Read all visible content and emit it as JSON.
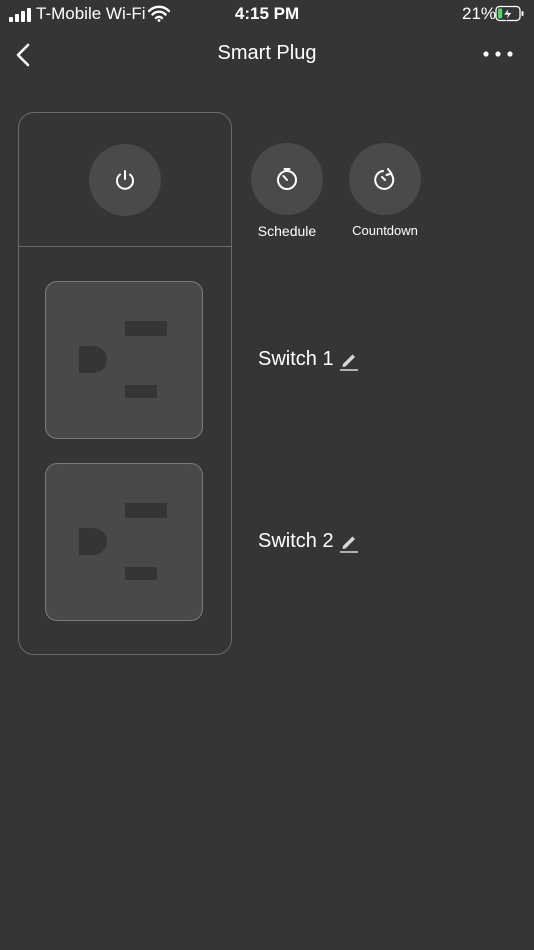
{
  "status_bar": {
    "carrier": "T-Mobile Wi-Fi",
    "time": "4:15 PM",
    "battery_percent": "21%",
    "battery_level": 0.21,
    "icons": [
      "signal-bars-icon",
      "wifi-icon",
      "battery-charging-icon"
    ]
  },
  "nav": {
    "title": "Smart Plug",
    "back_icon": "chevron-left-icon",
    "more_icon": "more-horizontal-icon"
  },
  "controls": {
    "power_icon": "power-icon",
    "schedule_icon": "timer-icon",
    "schedule_label": "Schedule",
    "countdown_icon": "countdown-icon",
    "countdown_label": "Countdown"
  },
  "switches": [
    {
      "label": "Switch 1",
      "edit_icon": "pencil-icon"
    },
    {
      "label": "Switch 2",
      "edit_icon": "pencil-icon"
    }
  ],
  "colors": {
    "background": "#363437",
    "button": "#4b494c",
    "outlet": "#4a484b",
    "border": "#6c6a6d",
    "battery_fill": "#4cd964"
  }
}
